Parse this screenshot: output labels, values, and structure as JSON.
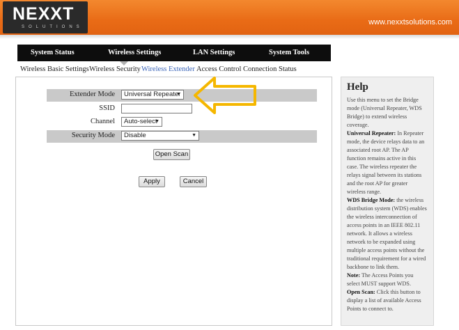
{
  "header": {
    "logo_text": "NEXXT",
    "logo_sub": "SOLUTIONS",
    "site_url": "www.nexxtsolutions.com",
    "accent_color": "#e96b16"
  },
  "topnav": {
    "tabs": [
      {
        "label": "System Status"
      },
      {
        "label": "Wireless Settings"
      },
      {
        "label": "LAN Settings"
      },
      {
        "label": "System Tools"
      }
    ],
    "active": "Wireless Settings"
  },
  "subnav": {
    "items": [
      {
        "label": "Wireless Basic Settings"
      },
      {
        "label": "Wireless Security"
      },
      {
        "label": "Wireless Extender"
      },
      {
        "label": "Access Control"
      },
      {
        "label": "Connection Status"
      }
    ],
    "active": "Wireless Extender",
    "active_color": "#3a64b8"
  },
  "form": {
    "extender_mode": {
      "label": "Extender Mode",
      "value": "Universal Repeater"
    },
    "ssid": {
      "label": "SSID",
      "value": ""
    },
    "channel": {
      "label": "Channel",
      "value": "Auto-select"
    },
    "security_mode": {
      "label": "Security Mode",
      "value": "Disable"
    },
    "open_scan_label": "Open Scan",
    "apply_label": "Apply",
    "cancel_label": "Cancel"
  },
  "callout": {
    "color": "#f5b700",
    "icon": "arrow-left-icon"
  },
  "help": {
    "title": "Help",
    "intro": "Use this menu to set the Bridge mode (Universal Repeater, WDS Bridge) to extend wireless coverage.",
    "universal_title": "Universal Repeater:",
    "universal_text": " In Repeater mode, the device relays data to an associated root AP. The AP function remains active in this case. The wireless repeater the relays signal between its stations and the root AP for greater wireless range.",
    "wds_title": "WDS Bridge Mode:",
    "wds_text": " the wireless distribution system (WDS) enables the wireless interconnection of access points in an IEEE 802.11 network. It allows a wireless network to be expanded using multiple access points without the traditional requirement for a wired backbone to link them.",
    "note_title": "Note:",
    "note_text": " The Access Points you select MUST support WDS.",
    "scan_title": "Open Scan:",
    "scan_text": " Click this button to display a list of available Access Points to connect to."
  }
}
